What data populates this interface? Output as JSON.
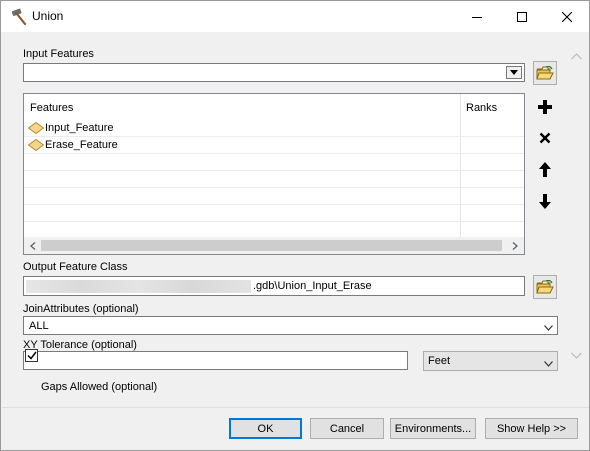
{
  "window": {
    "title": "Union",
    "icon": "hammer-icon"
  },
  "input_features": {
    "label": "Input Features",
    "value": ""
  },
  "features_table": {
    "columns": [
      "Features",
      "Ranks"
    ],
    "rows": [
      {
        "feature": "Input_Feature",
        "rank": ""
      },
      {
        "feature": "Erase_Feature",
        "rank": ""
      }
    ]
  },
  "output_feature_class": {
    "label": "Output Feature Class",
    "value": ".gdb\\Union_Input_Erase"
  },
  "join_attributes": {
    "label": "JoinAttributes (optional)",
    "value": "ALL"
  },
  "xy_tolerance": {
    "label": "XY Tolerance (optional)",
    "value": "",
    "unit": "Feet"
  },
  "gaps_allowed": {
    "label": "Gaps Allowed (optional)",
    "checked": true
  },
  "buttons": {
    "ok": "OK",
    "cancel": "Cancel",
    "environments": "Environments...",
    "show_help": "Show Help >>"
  },
  "colors": {
    "accent": "#0078d7",
    "feature_icon_fill": "#f3d58c",
    "feature_icon_stroke": "#b38a2c"
  }
}
